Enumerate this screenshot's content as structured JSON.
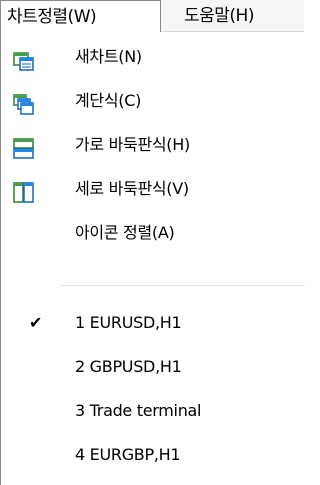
{
  "menubar": {
    "active_label": "차트정렬(W)",
    "help_label": "도움말(H)"
  },
  "menu": {
    "items": [
      {
        "label": "새차트(N)",
        "icon": "new-chart-icon"
      },
      {
        "label": "계단식(C)",
        "icon": "cascade-icon"
      },
      {
        "label": "가로 바둑판식(H)",
        "icon": "tile-horizontal-icon"
      },
      {
        "label": "세로 바둑판식(V)",
        "icon": "tile-vertical-icon"
      },
      {
        "label": "아이콘 정렬(A)",
        "icon": ""
      }
    ],
    "windows": [
      {
        "label": "1 EURUSD,H1",
        "checked": true
      },
      {
        "label": "2 GBPUSD,H1",
        "checked": false
      },
      {
        "label": "3 Trade terminal",
        "checked": false
      },
      {
        "label": "4 EURGBP,H1",
        "checked": false
      }
    ],
    "check_glyph": "✔"
  },
  "colors": {
    "icon_blue": "#1f6fc4",
    "icon_green": "#3f9a3a",
    "menubar_bg": "#f6f6f6"
  }
}
